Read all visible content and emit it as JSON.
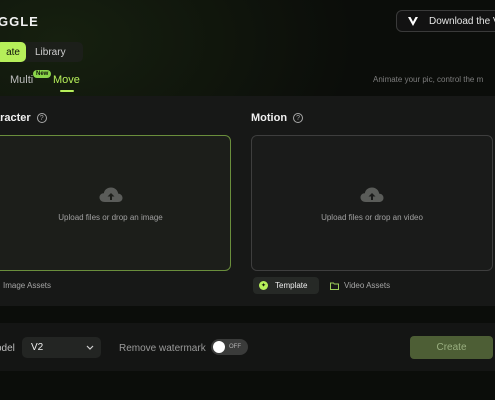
{
  "app": {
    "logo_text": "GGLE",
    "download_label": "Download the Vi"
  },
  "mode_switch": {
    "tabs": [
      {
        "label": "ate",
        "active": true
      },
      {
        "label": "Library",
        "active": false
      }
    ]
  },
  "subtabs": {
    "multi_label": "Multi",
    "new_badge": "New",
    "move_label": "Move"
  },
  "subtitle": "Animate your pic, control the m",
  "character": {
    "title": "aracter",
    "upload_text": "Upload files or drop an image",
    "assets_label": "Image Assets"
  },
  "motion": {
    "title": "Motion",
    "upload_text": "Upload files or drop an video",
    "template_label": "Template",
    "assets_label": "Video Assets"
  },
  "bottom": {
    "model_label": "odel",
    "model_value": "V2",
    "watermark_label": "Remove watermark",
    "toggle_text": "OFF",
    "create_label": "Create"
  },
  "colors": {
    "accent": "#b6ef5a",
    "background": "#0b0d0a",
    "panel": "#171817"
  },
  "icons": [
    "help-icon",
    "cloud-upload-icon",
    "template-icon",
    "folder-icon",
    "chevron-down-icon",
    "v-logo-icon"
  ]
}
